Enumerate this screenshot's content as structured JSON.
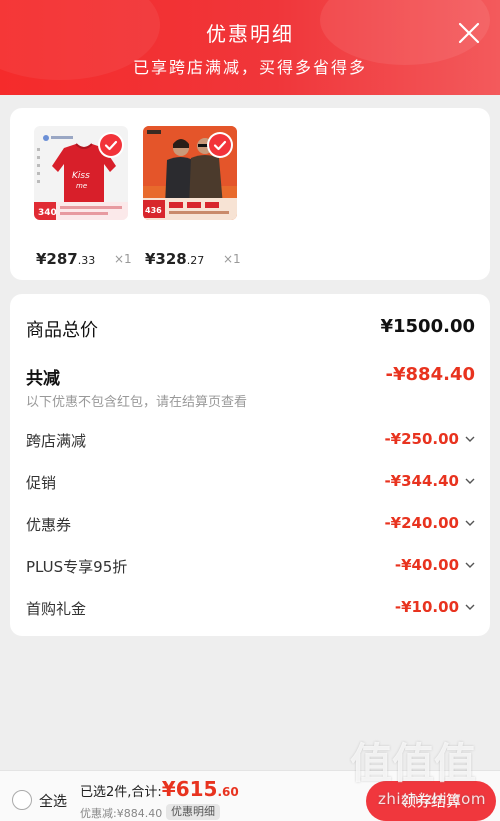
{
  "header": {
    "title": "优惠明细",
    "subtitle": "已享跨店满减，买得多省得多"
  },
  "products": [
    {
      "price_int": "¥287",
      "price_dec": ".33",
      "qty": "×1",
      "image": "red-sweater-product-icon"
    },
    {
      "price_int": "¥328",
      "price_dec": ".27",
      "qty": "×1",
      "image": "couple-jackets-product-icon"
    }
  ],
  "detail": {
    "total_label": "商品总价",
    "total_value": "¥1500.00",
    "reduce_label": "共减",
    "reduce_value": "-¥884.40",
    "reduce_note": "以下优惠不包含红包，请在结算页查看",
    "rows": [
      {
        "label": "跨店满减",
        "value": "-¥250.00"
      },
      {
        "label": "促销",
        "value": "-¥344.40"
      },
      {
        "label": "优惠券",
        "value": "-¥240.00"
      },
      {
        "label": "PLUS专享95折",
        "value": "-¥40.00"
      },
      {
        "label": "首购礼金",
        "value": "-¥10.00"
      }
    ]
  },
  "bottom": {
    "select_all": "全选",
    "selected_prefix": "已选2件,合计:",
    "total_symbol": "¥",
    "total_int": "615",
    "total_dec": ".60",
    "discount": "优惠减:¥884.40",
    "detail_tag": "优惠明细",
    "checkout": "领券结算"
  },
  "watermark": {
    "logo": "值值值",
    "text": "zhizhizhi.com"
  },
  "colors": {
    "accent": "#e8331f",
    "header_red": "#f52b2b"
  }
}
